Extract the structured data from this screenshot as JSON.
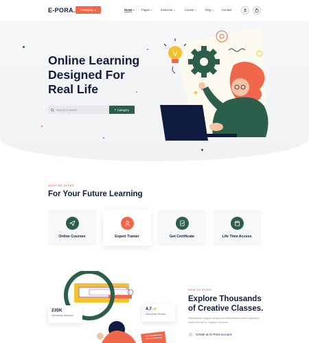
{
  "header": {
    "logo": "E-PORA.",
    "category_button": "Category",
    "nav": [
      {
        "label": "Home",
        "active": true
      },
      {
        "label": "Pages",
        "active": false
      },
      {
        "label": "Instructor",
        "active": false
      },
      {
        "label": "Course",
        "active": false
      },
      {
        "label": "Blog",
        "active": false
      },
      {
        "label": "Contact",
        "active": false
      }
    ],
    "icons": [
      "user-icon",
      "bag-icon"
    ]
  },
  "hero": {
    "title": "Online Learning Designed For Real Life",
    "search_placeholder": "Search Courses",
    "search_category": "Category"
  },
  "offer": {
    "kicker": "WHAT WE OFFER",
    "title": "For Your Future Learning",
    "cards": [
      {
        "label": "Online Courses",
        "icon": "send-icon",
        "color": "#2c5e4c"
      },
      {
        "label": "Expert Trainer",
        "icon": "user-icon",
        "color": "#f0674c"
      },
      {
        "label": "Get Certificate",
        "icon": "certificate-icon",
        "color": "#2c5e4c"
      },
      {
        "label": "Life Time Access",
        "icon": "calendar-icon",
        "color": "#2c5e4c"
      }
    ]
  },
  "stats": [
    {
      "value": "235K",
      "label": "Worldwide Students"
    },
    {
      "value": "4.7",
      "label": "Worldwide Review"
    }
  ],
  "explore": {
    "kicker": "HOW TO START",
    "title": "Explore Thousands of Creative Classes.",
    "description": "Dramatically supply transparent deliverables before backward comp internal or \"organic\" sources.",
    "items": [
      "Create an E-Pora account"
    ]
  },
  "colors": {
    "primary": "#0f1c3f",
    "accent": "#f0674c",
    "green": "#2c5e4c",
    "yellow": "#f5c12e"
  }
}
